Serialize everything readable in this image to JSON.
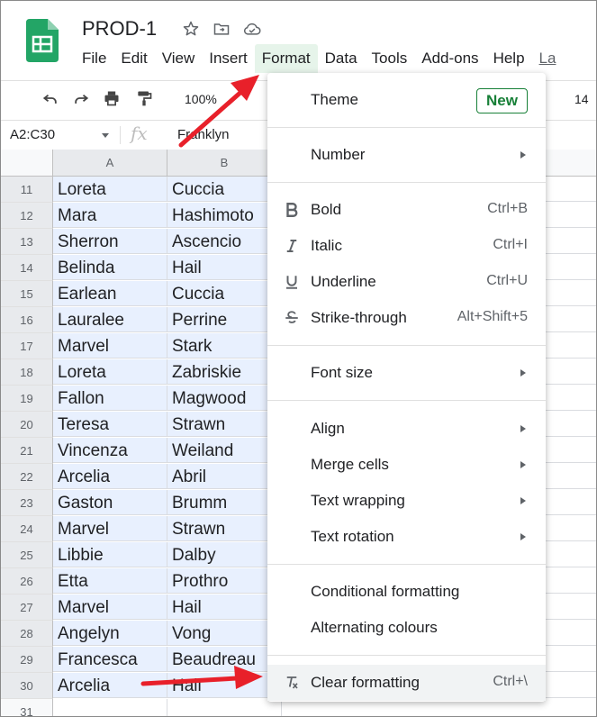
{
  "doc": {
    "title": "PROD-1"
  },
  "menubar": {
    "items": [
      "File",
      "Edit",
      "View",
      "Insert",
      "Format",
      "Data",
      "Tools",
      "Add-ons",
      "Help"
    ],
    "last_edit": "La",
    "active": "Format"
  },
  "toolbar": {
    "zoom": "100%",
    "font_size": "14"
  },
  "formula_bar": {
    "name_box": "A2:C30",
    "fx": "fx",
    "value": "Franklyn"
  },
  "columns": [
    "A",
    "B"
  ],
  "rows": [
    {
      "n": "11",
      "a": "Loreta",
      "b": "Cuccia"
    },
    {
      "n": "12",
      "a": "Mara",
      "b": "Hashimoto"
    },
    {
      "n": "13",
      "a": "Sherron",
      "b": "Ascencio"
    },
    {
      "n": "14",
      "a": "Belinda",
      "b": "Hail"
    },
    {
      "n": "15",
      "a": "Earlean",
      "b": "Cuccia"
    },
    {
      "n": "16",
      "a": "Lauralee",
      "b": "Perrine"
    },
    {
      "n": "17",
      "a": "Marvel",
      "b": "Stark"
    },
    {
      "n": "18",
      "a": "Loreta",
      "b": "Zabriskie"
    },
    {
      "n": "19",
      "a": "Fallon",
      "b": "Magwood"
    },
    {
      "n": "20",
      "a": "Teresa",
      "b": "Strawn"
    },
    {
      "n": "21",
      "a": "Vincenza",
      "b": "Weiland"
    },
    {
      "n": "22",
      "a": "Arcelia",
      "b": "Abril"
    },
    {
      "n": "23",
      "a": "Gaston",
      "b": "Brumm"
    },
    {
      "n": "24",
      "a": "Marvel",
      "b": "Strawn"
    },
    {
      "n": "25",
      "a": "Libbie",
      "b": "Dalby"
    },
    {
      "n": "26",
      "a": "Etta",
      "b": "Prothro"
    },
    {
      "n": "27",
      "a": "Marvel",
      "b": "Hail"
    },
    {
      "n": "28",
      "a": "Angelyn",
      "b": "Vong"
    },
    {
      "n": "29",
      "a": "Francesca",
      "b": "Beaudreau"
    },
    {
      "n": "30",
      "a": "Arcelia",
      "b": "Hail"
    },
    {
      "n": "31",
      "a": "",
      "b": ""
    }
  ],
  "format_menu": {
    "theme": {
      "label": "Theme",
      "badge": "New"
    },
    "number": {
      "label": "Number"
    },
    "bold": {
      "label": "Bold",
      "shortcut": "Ctrl+B"
    },
    "italic": {
      "label": "Italic",
      "shortcut": "Ctrl+I"
    },
    "underline": {
      "label": "Underline",
      "shortcut": "Ctrl+U"
    },
    "strike": {
      "label": "Strike-through",
      "shortcut": "Alt+Shift+5"
    },
    "font_size": {
      "label": "Font size"
    },
    "align": {
      "label": "Align"
    },
    "merge": {
      "label": "Merge cells"
    },
    "wrap": {
      "label": "Text wrapping"
    },
    "rotation": {
      "label": "Text rotation"
    },
    "conditional": {
      "label": "Conditional formatting"
    },
    "alternating": {
      "label": "Alternating colours"
    },
    "clear": {
      "label": "Clear formatting",
      "shortcut": "Ctrl+\\"
    }
  },
  "colors": {
    "accent_green": "#188038",
    "selection": "#e8f0fe",
    "annotation_arrow": "#e8202a"
  }
}
